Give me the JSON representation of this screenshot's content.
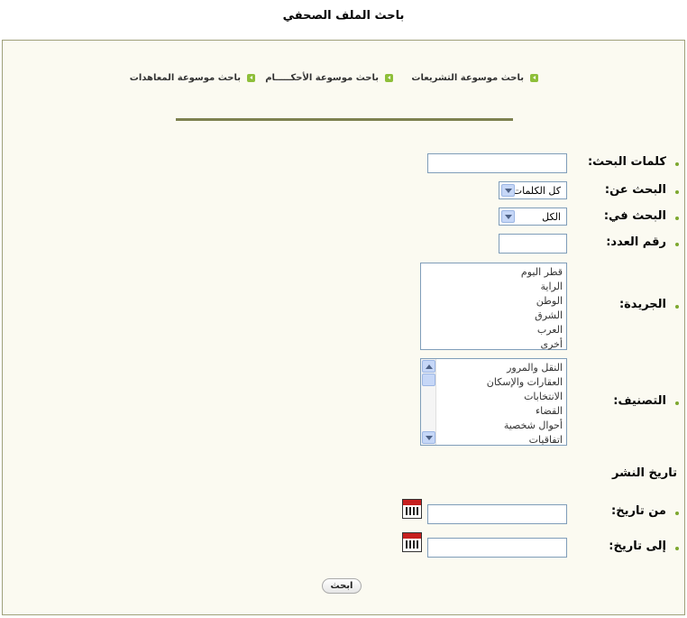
{
  "title": "باحث الملف الصحفي",
  "tabs": [
    {
      "label": "باحث موسوعة التشريعات"
    },
    {
      "label": "باحث موسوعة الأحكـــــام"
    },
    {
      "label": "باحث موسوعة المعاهدات"
    }
  ],
  "form": {
    "keywords": {
      "label": "كلمات البحث:",
      "value": ""
    },
    "search_for": {
      "label": "البحث عن:",
      "selected": "كل الكلمات"
    },
    "search_in": {
      "label": "البحث في:",
      "selected": "الكل"
    },
    "issue_number": {
      "label": "رقم العدد:",
      "value": ""
    },
    "newspaper": {
      "label": "الجريدة:",
      "options": [
        "قطر اليوم",
        "الراية",
        "الوطن",
        "الشرق",
        "العرب",
        "أخرى"
      ]
    },
    "category": {
      "label": "التصنيف:",
      "options": [
        "النقل والمرور",
        "العقارات والإسكان",
        "الانتخابات",
        "القضاء",
        "أحوال شخصية",
        "اتفاقيات"
      ]
    },
    "publish_date_heading": "تاريخ النشر",
    "from_date": {
      "label": "من تاريخ:",
      "value": ""
    },
    "to_date": {
      "label": "إلى تاريخ:",
      "value": ""
    },
    "submit_label": "ابحث"
  },
  "icons": {
    "calendar": "calendar-icon",
    "tab_bullet": "arrow-left-icon"
  },
  "colors": {
    "panel_background": "#fbfaf1",
    "panel_border": "#9fa07a",
    "divider": "#7d8150",
    "bullet_green": "#7ea830"
  }
}
